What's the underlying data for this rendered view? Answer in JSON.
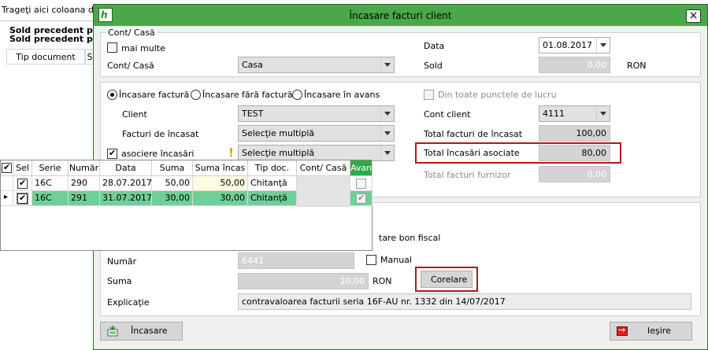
{
  "background": {
    "hint": "Trageţi aici coloana du",
    "sold_per": "Sold precedent per",
    "sold_pag": "Sold precedent pag",
    "col_tip": "Tip document",
    "col_s": "S"
  },
  "dialog": {
    "title": "Încasare facturi client",
    "logo_text": "h",
    "close_glyph": "×",
    "group_label": "Cont/ Casă",
    "mai_multe": "mai multe",
    "cont_casa_label": "Cont/ Casă",
    "cont_casa_value": "Casa",
    "data_label": "Data",
    "data_value": "01.08.2017",
    "sold_label": "Sold",
    "sold_value": "0,00",
    "sold_currency": "RON",
    "radio_incasare_factura": "Încasare factură",
    "radio_fara_factura": "Încasare fără factură",
    "radio_avans": "Încasare în avans",
    "din_toate": "Din toate punctele de lucru",
    "client_label": "Client",
    "client_value": "TEST",
    "cont_client_label": "Cont client",
    "cont_client_value": "4111",
    "facturi_label": "Facturi de încasat",
    "facturi_value": "Selecţie multiplă",
    "total_facturi_label": "Total facturi de încasat",
    "total_facturi_value": "100,00",
    "asociere_label": "asociere încasări",
    "warning_glyph": "!",
    "asociere_value": "Selecţie multiplă",
    "total_asociate_label": "Total încasări asociate",
    "total_asociate_value": "80,00",
    "total_furnizor_label": "Total facturi furnizor",
    "total_furnizor_value": "0,00",
    "bon_fiscal_partial": "tare bon fiscal",
    "numar_label": "Număr",
    "numar_value": "6441",
    "manual_label": "Manual",
    "suma_label": "Suma",
    "suma_value": "20,00",
    "suma_currency": "RON",
    "corelare_label": "Corelare",
    "explicatie_label": "Explicaţie",
    "explicatie_value": "contravaloarea facturii seria     16F-AU nr. 1332 din 14/07/2017",
    "incasare_btn": "Încasare",
    "iesire_btn": "Ieşire"
  },
  "colors": {
    "title_green": "#4aa84a",
    "row_green": "#6fcf97",
    "highlight_red": "#b01919",
    "avans_header": "#2eaa4a"
  },
  "grid": {
    "headers": [
      "Sel",
      "Serie",
      "Număr",
      "Data",
      "Suma",
      "Suma încas",
      "Tip doc.",
      "Cont/ Casă",
      "Avans"
    ],
    "rows": [
      {
        "serie": "16C",
        "numar": "290",
        "data": "28.07.2017",
        "suma": "50,00",
        "suma_incas": "50,00",
        "tip": "Chitanţă",
        "sel": true,
        "avans": false
      },
      {
        "serie": "16C",
        "numar": "291",
        "data": "31.07.2017",
        "suma": "30,00",
        "suma_incas": "30,00",
        "tip": "Chitanţă",
        "sel": true,
        "avans": true
      }
    ],
    "current_row_glyph": "▸"
  }
}
